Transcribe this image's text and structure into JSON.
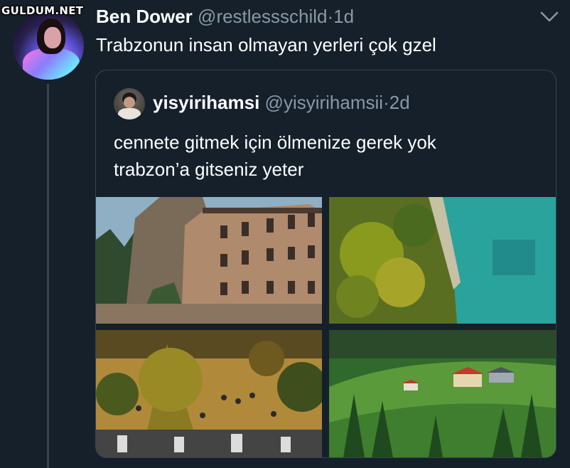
{
  "watermark": "GULDUM.NET",
  "tweet": {
    "author_name": "Ben Dower",
    "handle": "@restlessschild",
    "separator": "·",
    "time": "1d",
    "text": "Trabzonun insan olmayan yerleri çok gzel"
  },
  "quoted_tweet": {
    "author_name": "yisyirihamsi",
    "handle": "@yisyirihamsii",
    "separator": "·",
    "time": "2d",
    "text_line1": "cennete gitmek için ölmenize gerek yok",
    "text_line2": "trabzon’a gitseniz yeter"
  },
  "icons": [
    "chevron-down-icon"
  ],
  "colors": {
    "background": "#15202b",
    "secondary_text": "#8899a6",
    "border": "#38444d"
  }
}
